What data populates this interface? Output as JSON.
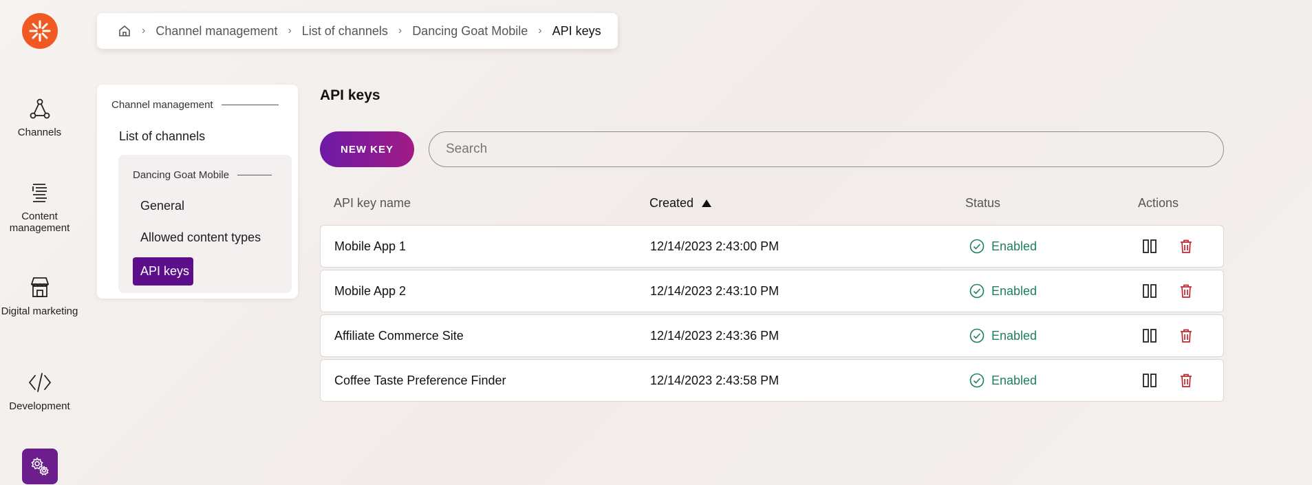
{
  "nav": {
    "items": [
      {
        "label": "Channels",
        "icon": "channels-icon"
      },
      {
        "label": "Content management",
        "icon": "content-management-icon"
      },
      {
        "label": "Digital marketing",
        "icon": "digital-marketing-icon"
      },
      {
        "label": "Development",
        "icon": "development-icon"
      }
    ],
    "settings_icon": "settings-gear-icon"
  },
  "breadcrumb": {
    "home_icon": "home-icon",
    "items": [
      "Channel management",
      "List of channels",
      "Dancing Goat Mobile",
      "API keys"
    ]
  },
  "tree": {
    "heading": "Channel management",
    "list_link": "List of channels",
    "group_heading": "Dancing Goat Mobile",
    "items": [
      "General",
      "Allowed content types",
      "API keys"
    ],
    "active_item": "API keys"
  },
  "main": {
    "title": "API keys",
    "new_key_label": "NEW KEY",
    "search_placeholder": "Search",
    "columns": [
      "API key name",
      "Created",
      "Status",
      "Actions"
    ],
    "sort_column": "Created",
    "rows": [
      {
        "name": "Mobile App 1",
        "created": "12/14/2023 2:43:00 PM",
        "status": "Enabled"
      },
      {
        "name": "Mobile App 2",
        "created": "12/14/2023 2:43:10 PM",
        "status": "Enabled"
      },
      {
        "name": "Affiliate Commerce Site",
        "created": "12/14/2023 2:43:36 PM",
        "status": "Enabled"
      },
      {
        "name": "Coffee Taste Preference Finder",
        "created": "12/14/2023 2:43:58 PM",
        "status": "Enabled"
      }
    ]
  },
  "colors": {
    "brand_orange": "#f05a22",
    "brand_purple": "#5c0e8b",
    "status_green": "#1e7f5b",
    "delete_red": "#c0262d"
  }
}
